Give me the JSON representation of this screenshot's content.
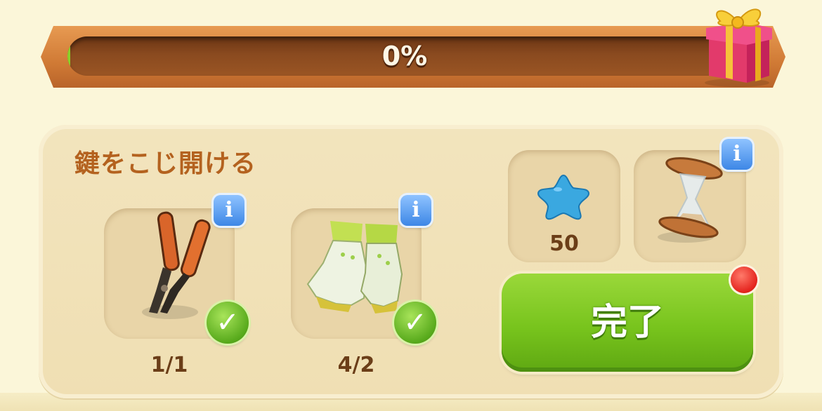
{
  "progress": {
    "value_fraction": 0.0,
    "label": "0%"
  },
  "task": {
    "title": "鍵をこじ開ける"
  },
  "requirements": [
    {
      "icon": "bolt-cutter-icon",
      "count_label": "1/1",
      "completed": true
    },
    {
      "icon": "garden-gloves-icon",
      "count_label": "4/2",
      "completed": true
    }
  ],
  "rewards": [
    {
      "icon": "blue-star-icon",
      "amount": "50"
    },
    {
      "icon": "hourglass-icon"
    }
  ],
  "info_label": "i",
  "check_label": "✓",
  "done_button": {
    "label": "完了"
  },
  "colors": {
    "background": "#fbf6d9",
    "panel": "#f2e4bd",
    "button_green": "#78c41d",
    "title_brown": "#b4621f",
    "info_blue": "#3d87e6",
    "notification_red": "#e4231d"
  }
}
